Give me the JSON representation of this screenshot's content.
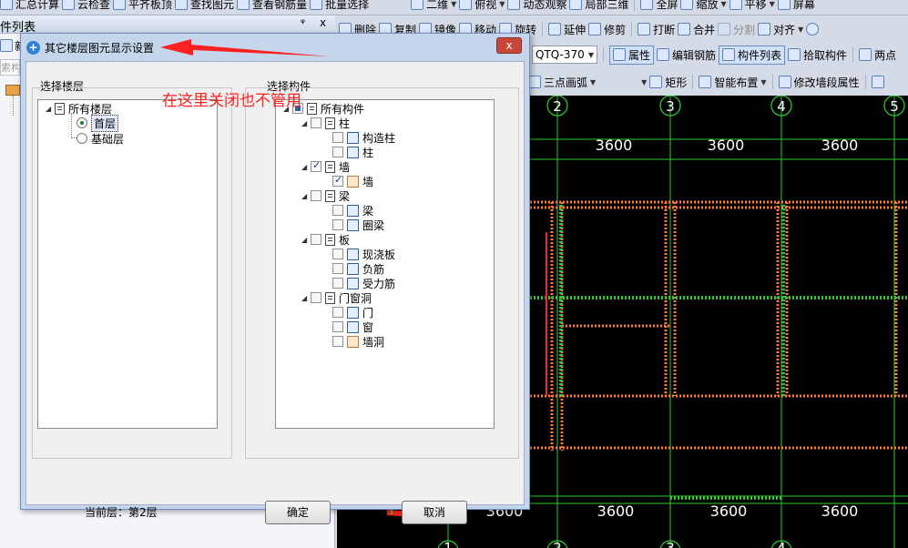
{
  "toolbar_top": {
    "items": [
      "汇总计算",
      "云检查",
      "平齐板顶",
      "查找图元",
      "查看钢筋量",
      "批量选择",
      "二维",
      "俯视",
      "动态观察",
      "局部三维",
      "全屏",
      "缩放",
      "平移",
      "屏幕"
    ]
  },
  "toolbar_edit": {
    "items": [
      "删除",
      "复制",
      "镜像",
      "移动",
      "旋转",
      "延伸",
      "修剪",
      "打断",
      "合并",
      "分割",
      "对齐"
    ]
  },
  "toolbar_prop": {
    "combo_value": "QTQ-370",
    "items": [
      "属性",
      "编辑钢筋",
      "构件列表",
      "拾取构件",
      "两点"
    ]
  },
  "toolbar_draw": {
    "items": [
      "三点画弧",
      "矩形",
      "智能布置",
      "修改墙段属性"
    ]
  },
  "left_panel": {
    "title": "件列表",
    "pin": "ᵠ",
    "close": "x",
    "new_label": "新",
    "search_label": "索构"
  },
  "canvas": {
    "axis_labels_top": [
      "2",
      "3",
      "4",
      "5"
    ],
    "axis_labels_bottom": [
      "1",
      "2",
      "3",
      "4"
    ],
    "dims_top": [
      "3600",
      "3600",
      "3600"
    ],
    "dims_bottom": [
      "3600",
      "3600",
      "3600",
      "3600"
    ],
    "colors": {
      "grid": "#2bd12b",
      "wall": "#ff7a3c",
      "band": "#37c23a",
      "red": "#ff2020"
    }
  },
  "annotation": "在这里关闭也不管用",
  "dialog": {
    "title": "其它楼层图元显示设置",
    "close": "x",
    "floor_group_label": "选择楼层",
    "component_group_label": "选择构件",
    "floors": {
      "root": "所有楼层",
      "items": [
        {
          "label": "首层",
          "selected": true
        },
        {
          "label": "基础层",
          "selected": false
        }
      ]
    },
    "components": {
      "root": "所有构件",
      "groups": [
        {
          "label": "柱",
          "checked": false,
          "children": [
            {
              "label": "构造柱",
              "checked": false
            },
            {
              "label": "柱",
              "checked": false
            }
          ]
        },
        {
          "label": "墙",
          "checked": true,
          "children": [
            {
              "label": "墙",
              "checked": true
            }
          ]
        },
        {
          "label": "梁",
          "checked": false,
          "children": [
            {
              "label": "梁",
              "checked": false
            },
            {
              "label": "圈梁",
              "checked": false
            }
          ]
        },
        {
          "label": "板",
          "checked": false,
          "children": [
            {
              "label": "现浇板",
              "checked": false
            },
            {
              "label": "负筋",
              "checked": false
            },
            {
              "label": "受力筋",
              "checked": false
            }
          ]
        },
        {
          "label": "门窗洞",
          "checked": false,
          "children": [
            {
              "label": "门",
              "checked": false
            },
            {
              "label": "窗",
              "checked": false
            },
            {
              "label": "墙洞",
              "checked": false
            }
          ]
        }
      ]
    },
    "current_floor": "当前层：第2层",
    "ok_label": "确定",
    "cancel_label": "取消"
  }
}
